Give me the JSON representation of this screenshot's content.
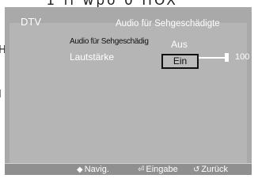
{
  "background": {
    "top_text": "ʻ1 ll wpo 0 HOX",
    "left_h": "H",
    "left_l": "I"
  },
  "screen": {
    "source": "DTV",
    "menu_title": "Audio für Sehgeschädigte"
  },
  "menu": {
    "audio_label": "Audio für Sehgeschädig",
    "volume_label": "Lautstärke",
    "volume_value": "100",
    "volume_level_percent": 100
  },
  "dropdown": {
    "options": [
      "Aus",
      "Ein"
    ],
    "selected": "Ein"
  },
  "footer": {
    "nav_icon": "updown-arrow-icon",
    "nav_glyph": "◆",
    "nav": "Navig.",
    "enter_icon": "enter-icon",
    "enter_glyph": "⏎",
    "enter": "Eingabe",
    "back_icon": "return-icon",
    "back_glyph": "↺",
    "back": "Zurück"
  },
  "colors": {
    "screen_bg": "#a9a9a9",
    "panel_bg": "#b5b5b5",
    "footer_bg": "#8f8f8f",
    "text_white": "#ffffff"
  }
}
